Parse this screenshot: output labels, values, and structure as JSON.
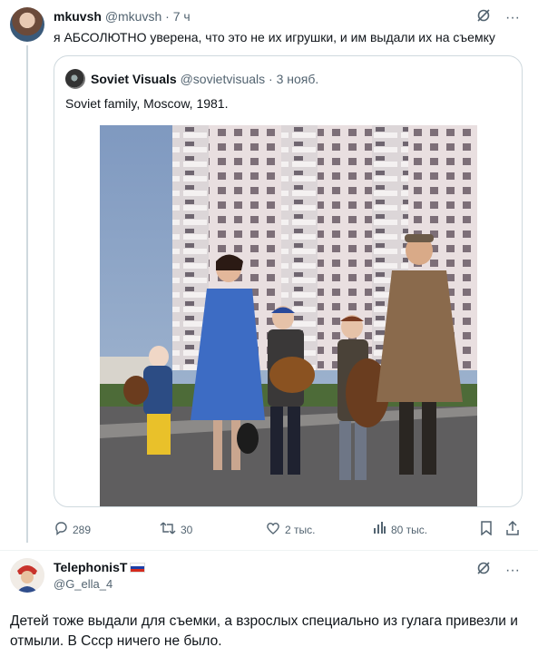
{
  "post": {
    "author_name": "mkuvsh",
    "author_handle": "@mkuvsh",
    "separator": "·",
    "time": "7 ч",
    "text": "я АБСОЛЮТНО уверена, что это не их игрушки, и им выдали их на съемку",
    "icons": [
      "grok-icon",
      "more-icon"
    ]
  },
  "quote": {
    "author_name": "Soviet Visuals",
    "author_handle": "@sovietvisuals",
    "separator": "·",
    "date": "3 нояб.",
    "text": "Soviet family, Moscow, 1981."
  },
  "actions": {
    "replies": "289",
    "reposts": "30",
    "likes": "2 тыс.",
    "views": "80 тыс."
  },
  "reply": {
    "author_name": "TelephonisT",
    "author_handle": "@G_ella_4",
    "text": "Детей тоже выдали для съемки, а взрослых специально из гулага привезли и отмыли. В Ссср ничего не было."
  },
  "colors": {
    "text": "#0f1419",
    "secondary": "#536471",
    "border": "#cfd9de"
  }
}
